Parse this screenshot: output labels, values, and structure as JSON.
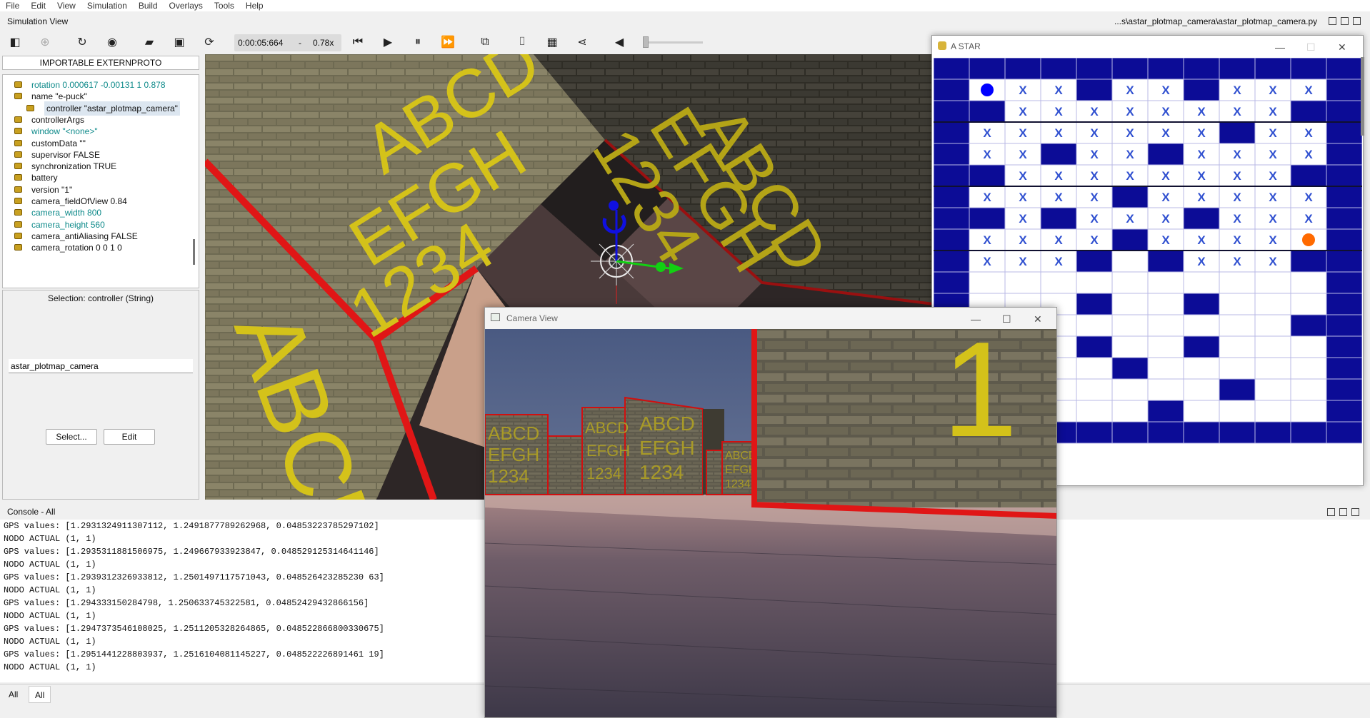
{
  "menu": [
    "File",
    "Edit",
    "View",
    "Simulation",
    "Build",
    "Overlays",
    "Tools",
    "Help"
  ],
  "sim_view_title": "Simulation View",
  "controller_file": "...s\\astar_plotmap_camera\\astar_plotmap_camera.py",
  "toolbar": {
    "time": "0:00:05:664",
    "separator": "-",
    "speed": "0.78x"
  },
  "left_panel": {
    "proto_button": "IMPORTABLE EXTERNPROTO",
    "tree_items": [
      {
        "label": "rotation 0.000617 -0.00131 1 0.878",
        "style": "teal"
      },
      {
        "label": "name \"e-puck\"",
        "style": "normal"
      },
      {
        "label": "controller \"astar_plotmap_camera\"",
        "style": "selected"
      },
      {
        "label": "controllerArgs",
        "style": "normal"
      },
      {
        "label": "window \"<none>\"",
        "style": "teal"
      },
      {
        "label": "customData \"\"",
        "style": "normal"
      },
      {
        "label": "supervisor FALSE",
        "style": "normal"
      },
      {
        "label": "synchronization TRUE",
        "style": "normal"
      },
      {
        "label": "battery",
        "style": "normal"
      },
      {
        "label": "version \"1\"",
        "style": "normal"
      },
      {
        "label": "camera_fieldOfView 0.84",
        "style": "normal"
      },
      {
        "label": "camera_width 800",
        "style": "teal"
      },
      {
        "label": "camera_height 560",
        "style": "teal"
      },
      {
        "label": "camera_antiAliasing FALSE",
        "style": "normal"
      },
      {
        "label": "camera_rotation 0 0 1 0",
        "style": "normal"
      }
    ],
    "selection_title": "Selection: controller (String)",
    "selection_value": "astar_plotmap_camera",
    "select_button": "Select...",
    "edit_button": "Edit"
  },
  "astar": {
    "title": "A STAR",
    "grid": [
      "BBBBBBBBBBBB",
      "BSXXBXXBXXXB",
      "BBXXXXXXXXBB",
      "BXXXXXXXBXXB",
      "BXXBXXBXXXXB",
      "BBXXXXXXXXBB",
      "BXXXXBXXXXXB",
      "BBXBXXXBXXXB",
      "BXXXXBXXXXGB",
      "BXXXBWBXXXBB",
      "BWWWWWWWWWWB",
      "BWWWBWWBWWWB",
      "BWWWWWWWWWBB",
      "BWWWBWWBWWWB",
      "BWWWWBWWWWWB",
      "BWWWWWWWBWWB",
      "BWWWWWBWWWWB",
      "BBBBBBBBBBBB"
    ],
    "colors": {
      "wall": "#0c0c96",
      "start": "#0000ff",
      "goal": "#ff6a00",
      "grid": "#b8b8e6"
    },
    "mark": "X"
  },
  "camera_window": {
    "title": "Camera View"
  },
  "scene_text": {
    "line1": "ABCD",
    "line2": "EFGH",
    "line3": "1234",
    "big": "1"
  },
  "console": {
    "title": "Console - All",
    "lines": [
      "GPS values: [1.2931324911307112, 1.2491877789262968, 0.04853223785297102]",
      "NODO ACTUAL (1, 1)",
      "GPS values: [1.2935311881506975, 1.249667933923847, 0.048529125314641146]",
      "NODO ACTUAL (1, 1)",
      "GPS values: [1.2939312326933812, 1.2501497117571043, 0.048526423285230 63]",
      "NODO ACTUAL (1, 1)",
      "GPS values: [1.294333150284798, 1.250633745322581, 0.04852429432866156]",
      "NODO ACTUAL (1, 1)",
      "GPS values: [1.2947373546108025, 1.2511205328264865, 0.048522866800330675]",
      "NODO ACTUAL (1, 1)",
      "GPS values: [1.2951441228803937, 1.2516104081145227, 0.048522226891461 19]",
      "NODO ACTUAL (1, 1)"
    ],
    "tabs": [
      "All",
      "All"
    ]
  }
}
